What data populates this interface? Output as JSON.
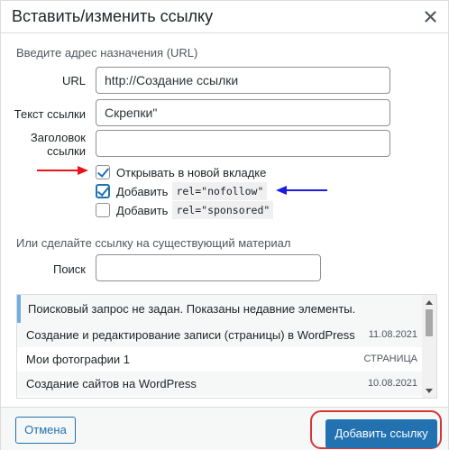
{
  "dialog": {
    "title": "Вставить/изменить ссылку",
    "close_icon": "close-icon"
  },
  "form": {
    "hint": "Введите адрес назначения (URL)",
    "url_label": "URL",
    "url_value": "http://Создание ссылки",
    "text_label": "Текст ссылки",
    "text_value": "Скрепки\"",
    "title_label_line1": "Заголовок",
    "title_label_line2": "ссылки",
    "title_value": "",
    "options": [
      {
        "label": "Открывать в новой вкладке",
        "code": "",
        "checked": true
      },
      {
        "label": "Добавить",
        "code": "rel=\"nofollow\"",
        "checked": true
      },
      {
        "label": "Добавить",
        "code": "rel=\"sponsored\"",
        "checked": false
      }
    ],
    "annotation_colors": {
      "red_arrow": "#e8141c",
      "blue_arrow": "#1d1be0"
    }
  },
  "existing": {
    "section_title": "Или сделайте ссылку на существующий материал",
    "search_label": "Поиск",
    "search_value": "",
    "notice": "Поисковый запрос не задан. Показаны недавние элементы.",
    "results": [
      {
        "title": "Создание и редактирование записи (страницы) в WordPress",
        "meta": "11.08.2021"
      },
      {
        "title": "Мои фотографии 1",
        "meta": "СТРАНИЦА"
      },
      {
        "title": "Создание сайтов на WordPress",
        "meta": "10.08.2021"
      }
    ]
  },
  "footer": {
    "cancel_label": "Отмена",
    "submit_label": "Добавить ссылку",
    "highlight_color": "#d63638"
  },
  "colors": {
    "accent": "#2271b1"
  }
}
